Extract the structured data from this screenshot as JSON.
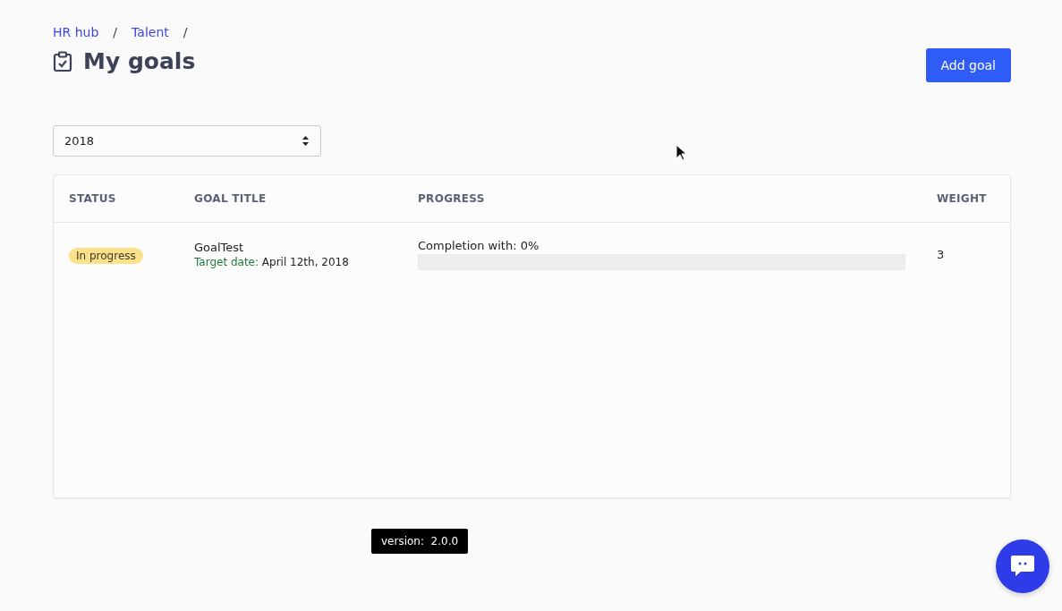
{
  "breadcrumbs": [
    "HR hub",
    "Talent"
  ],
  "breadcrumb_separator": "/",
  "title": "My goals",
  "add_button": "Add goal",
  "year_select": {
    "value": "2018"
  },
  "table": {
    "columns": [
      "STATUS",
      "GOAL TITLE",
      "PROGRESS",
      "WEIGHT"
    ],
    "rows": [
      {
        "status": "In progress",
        "title": "GoalTest",
        "target_label": "Target date:",
        "target_date": "April 12th, 2018",
        "progress_text": "Completion with: 0%",
        "level": 0,
        "weight": "3"
      }
    ]
  },
  "version": "version:  2.0.0"
}
